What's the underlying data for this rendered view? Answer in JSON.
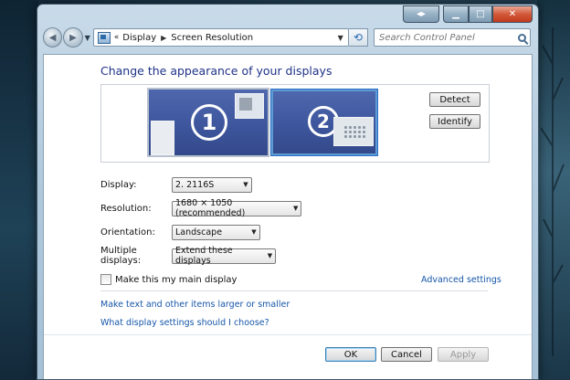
{
  "window": {
    "nav": {
      "breadcrumb": [
        "Display",
        "Screen Resolution"
      ],
      "search_placeholder": "Search Control Panel"
    }
  },
  "page": {
    "heading": "Change the appearance of your displays",
    "monitors": [
      {
        "number": "1",
        "selected": false
      },
      {
        "number": "2",
        "selected": true
      }
    ],
    "detect_label": "Detect",
    "identify_label": "Identify",
    "fields": {
      "display": {
        "label": "Display:",
        "value": "2. 2116S"
      },
      "resolution": {
        "label": "Resolution:",
        "value": "1680 × 1050 (recommended)"
      },
      "orientation": {
        "label": "Orientation:",
        "value": "Landscape"
      },
      "multiple": {
        "label": "Multiple displays:",
        "value": "Extend these displays"
      }
    },
    "main_display_checkbox": {
      "label": "Make this my main display",
      "checked": false
    },
    "advanced_link": "Advanced settings",
    "links": {
      "text_size": "Make text and other items larger or smaller",
      "which_settings": "What display settings should I choose?"
    },
    "buttons": {
      "ok": "OK",
      "cancel": "Cancel",
      "apply": "Apply"
    }
  },
  "colors": {
    "link": "#1556a8",
    "heading": "#1e3287",
    "monitor": "#3c549b",
    "selected_border": "#2d6dc0"
  }
}
